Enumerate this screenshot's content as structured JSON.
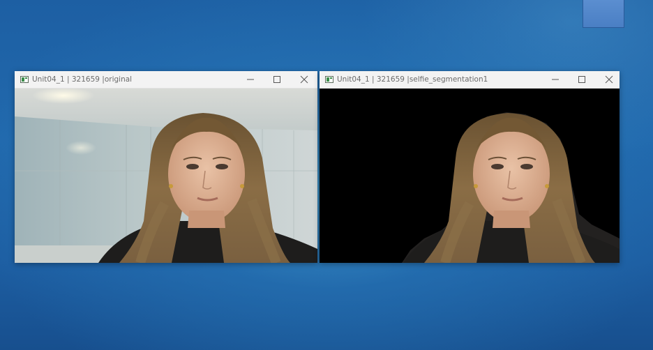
{
  "windows": [
    {
      "title": "Unit04_1 | 321659 |original",
      "view": "original"
    },
    {
      "title": "Unit04_1 | 321659 |selfie_segmentation1",
      "view": "segmented"
    }
  ],
  "controls": {
    "minimize_icon": "minimize-icon",
    "maximize_icon": "maximize-icon",
    "close_icon": "close-icon"
  },
  "colors": {
    "desktop_blue": "#1d5fa3",
    "titlebar": "#f3f3f3",
    "mask_background": "#000000"
  }
}
